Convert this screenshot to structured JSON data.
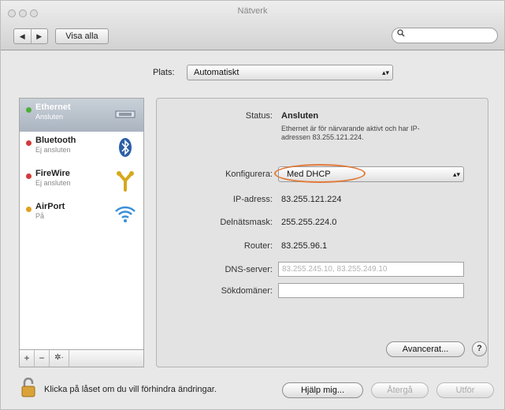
{
  "window": {
    "title": "Nätverk"
  },
  "toolbar": {
    "back": "◀",
    "forward": "▶",
    "show_all": "Visa alla",
    "search_placeholder": ""
  },
  "location": {
    "label": "Plats:",
    "value": "Automatiskt"
  },
  "services": [
    {
      "name": "Ethernet",
      "status": "Ansluten",
      "dot_color": "#4fae3a",
      "icon": "ethernet-icon",
      "selected": true
    },
    {
      "name": "Bluetooth",
      "status": "Ej ansluten",
      "dot_color": "#d23a3a",
      "icon": "bluetooth-icon",
      "selected": false
    },
    {
      "name": "FireWire",
      "status": "Ej ansluten",
      "dot_color": "#d23a3a",
      "icon": "firewire-icon",
      "selected": false
    },
    {
      "name": "AirPort",
      "status": "På",
      "dot_color": "#e0a020",
      "icon": "airport-icon",
      "selected": false
    }
  ],
  "list_controls": {
    "add": "+",
    "remove": "−",
    "action": "✲·"
  },
  "detail": {
    "status_label": "Status:",
    "status_value": "Ansluten",
    "status_desc_line1": "Ethernet är för närvarande aktivt och har IP-",
    "status_desc_line2": "adressen 83.255.121.224.",
    "configure_label": "Konfigurera:",
    "configure_value": "Med DHCP",
    "ip_label": "IP-adress:",
    "ip_value": "83.255.121.224",
    "mask_label": "Delnätsmask:",
    "mask_value": "255.255.224.0",
    "router_label": "Router:",
    "router_value": "83.255.96.1",
    "dns_label": "DNS-server:",
    "dns_placeholder": "83.255.245.10, 83.255.249.10",
    "search_domains_label": "Sökdomäner:",
    "search_domains_value": "",
    "advanced_button": "Avancerat...",
    "help_button": "?"
  },
  "footer": {
    "lock_text": "Klicka på låset om du vill förhindra ändringar.",
    "help_me": "Hjälp mig...",
    "revert": "Återgå",
    "apply": "Utför"
  },
  "colors": {
    "highlight_circle": "#e07a3a",
    "selection": "#aab4c0",
    "airport_blue": "#3a8fd8",
    "bluetooth_blue": "#2c5fa8"
  }
}
